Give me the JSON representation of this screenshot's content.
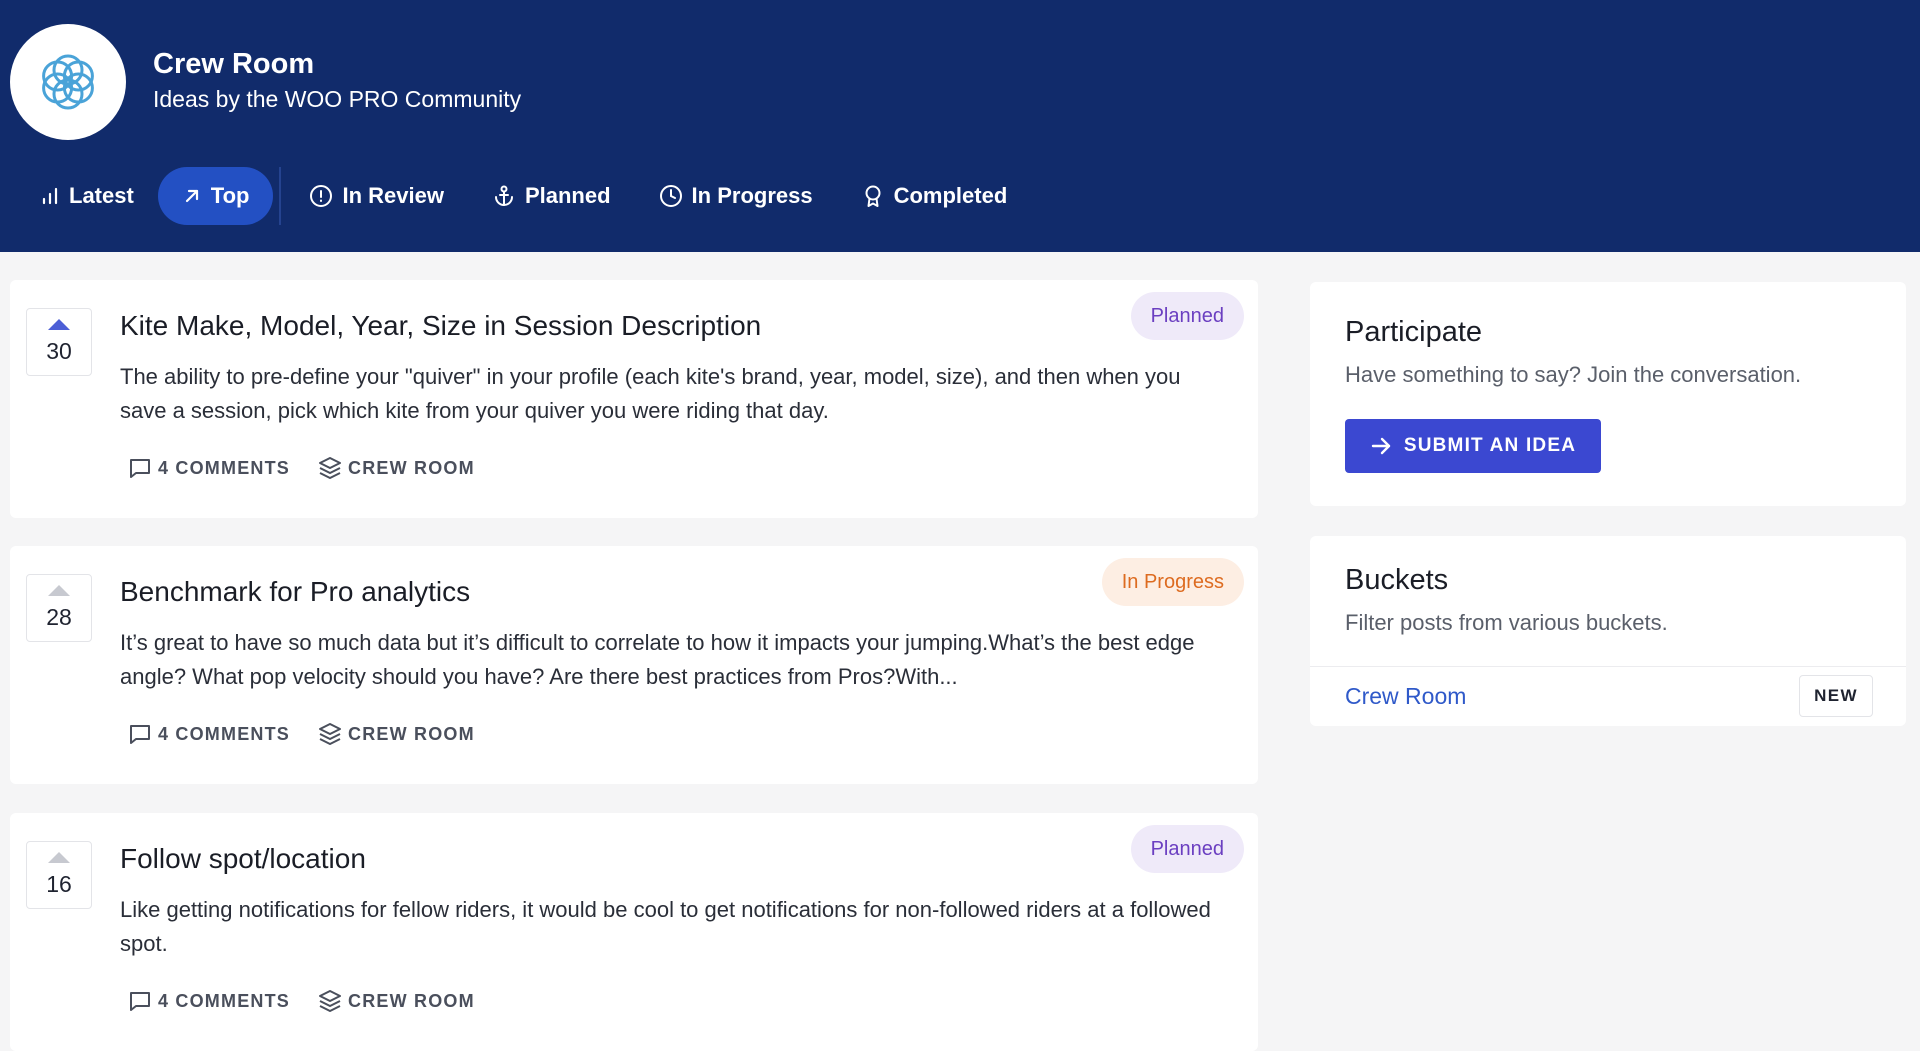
{
  "header": {
    "title": "Crew Room",
    "subtitle": "Ideas by the WOO PRO Community",
    "logo_icon": "flower-of-life-icon"
  },
  "nav": {
    "items": [
      {
        "label": "Latest",
        "icon": "bar-chart-icon"
      },
      {
        "label": "Top",
        "icon": "arrow-up-right-icon",
        "active": true
      },
      {
        "label": "In Review",
        "icon": "alert-circle-icon"
      },
      {
        "label": "Planned",
        "icon": "anchor-icon"
      },
      {
        "label": "In Progress",
        "icon": "clock-icon"
      },
      {
        "label": "Completed",
        "icon": "award-icon"
      }
    ]
  },
  "posts": [
    {
      "votes": "30",
      "title": "Kite Make, Model, Year, Size in Session Description",
      "description": "The ability to pre-define your \"quiver\" in your profile (each kite's brand, year, model, size), and then when you save a session, pick which kite from your quiver you were riding that day.",
      "status": "Planned",
      "comments": "4 COMMENTS",
      "bucket": "CREW ROOM"
    },
    {
      "votes": "28",
      "title": "Benchmark for Pro analytics",
      "description": "It’s great to have so much data but it’s difficult to correlate to how it impacts your jumping.What’s the best edge angle? What pop velocity should you have? Are there best practices from Pros?With...",
      "status": "In Progress",
      "comments": "4 COMMENTS",
      "bucket": "CREW ROOM"
    },
    {
      "votes": "16",
      "title": "Follow spot/location",
      "description": "Like getting notifications for fellow riders, it would be cool to get notifications for non-followed riders at a followed spot.",
      "status": "Planned",
      "comments": "4 COMMENTS",
      "bucket": "CREW ROOM"
    }
  ],
  "participate": {
    "title": "Participate",
    "subtitle": "Have something to say? Join the conversation.",
    "button_label": "SUBMIT AN IDEA"
  },
  "buckets": {
    "title": "Buckets",
    "subtitle": "Filter posts from various buckets.",
    "items": [
      {
        "label": "Crew Room",
        "tag": "NEW"
      }
    ]
  },
  "colors": {
    "header_bg": "#112b6b",
    "active_tab": "#2350c3",
    "primary_button": "#3b48d1",
    "planned": "#6b3fc1",
    "in_progress": "#dd6b20"
  }
}
